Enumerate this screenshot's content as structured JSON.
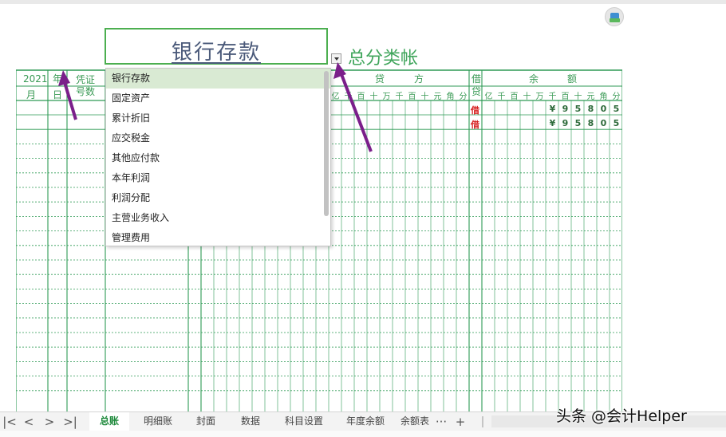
{
  "title": "银行存款",
  "subtitle": "总分类帐",
  "header": {
    "year": "2021",
    "year_label": "年",
    "voucher_line1": "凭证",
    "voucher_line2": "号数",
    "month": "月",
    "day": "日",
    "credit_label_1": "贷",
    "credit_label_2": "方",
    "direction_line1": "借",
    "direction_line2": "贷",
    "balance_label_1": "余",
    "balance_label_2": "额"
  },
  "digit_columns_credit": [
    "亿",
    "千",
    "百",
    "十",
    "万",
    "千",
    "百",
    "十",
    "元",
    "角",
    "分"
  ],
  "digit_columns_balance": [
    "亿",
    "千",
    "百",
    "十",
    "万",
    "千",
    "百",
    "十",
    "元",
    "角",
    "分"
  ],
  "rows": [
    {
      "direction": "借",
      "balance_digits": [
        "¥",
        "9",
        "5",
        "8",
        "0",
        "5"
      ]
    },
    {
      "direction": "借",
      "balance_digits": [
        "¥",
        "9",
        "5",
        "8",
        "0",
        "5"
      ]
    }
  ],
  "dropdown": {
    "items": [
      "银行存款",
      "固定资产",
      "累计折旧",
      "应交税金",
      "其他应付款",
      "本年利润",
      "利润分配",
      "主营业务收入",
      "管理费用"
    ],
    "selected_index": 0
  },
  "sheet_tabs": [
    "总账",
    "明细账",
    "封面",
    "数据",
    "科目设置",
    "年度余额",
    "余额表"
  ],
  "active_tab": "总账",
  "nav": {
    "first": "|<",
    "prev": "<",
    "next": ">",
    "last": ">|",
    "more": "···",
    "add": "+"
  },
  "watermark": "头条 @会计Helper",
  "colors": {
    "grid": "#2e9a55",
    "accent": "#1f8a3c",
    "arrow": "#7a1f8a",
    "dropdown_selected": "#d9ead3"
  }
}
